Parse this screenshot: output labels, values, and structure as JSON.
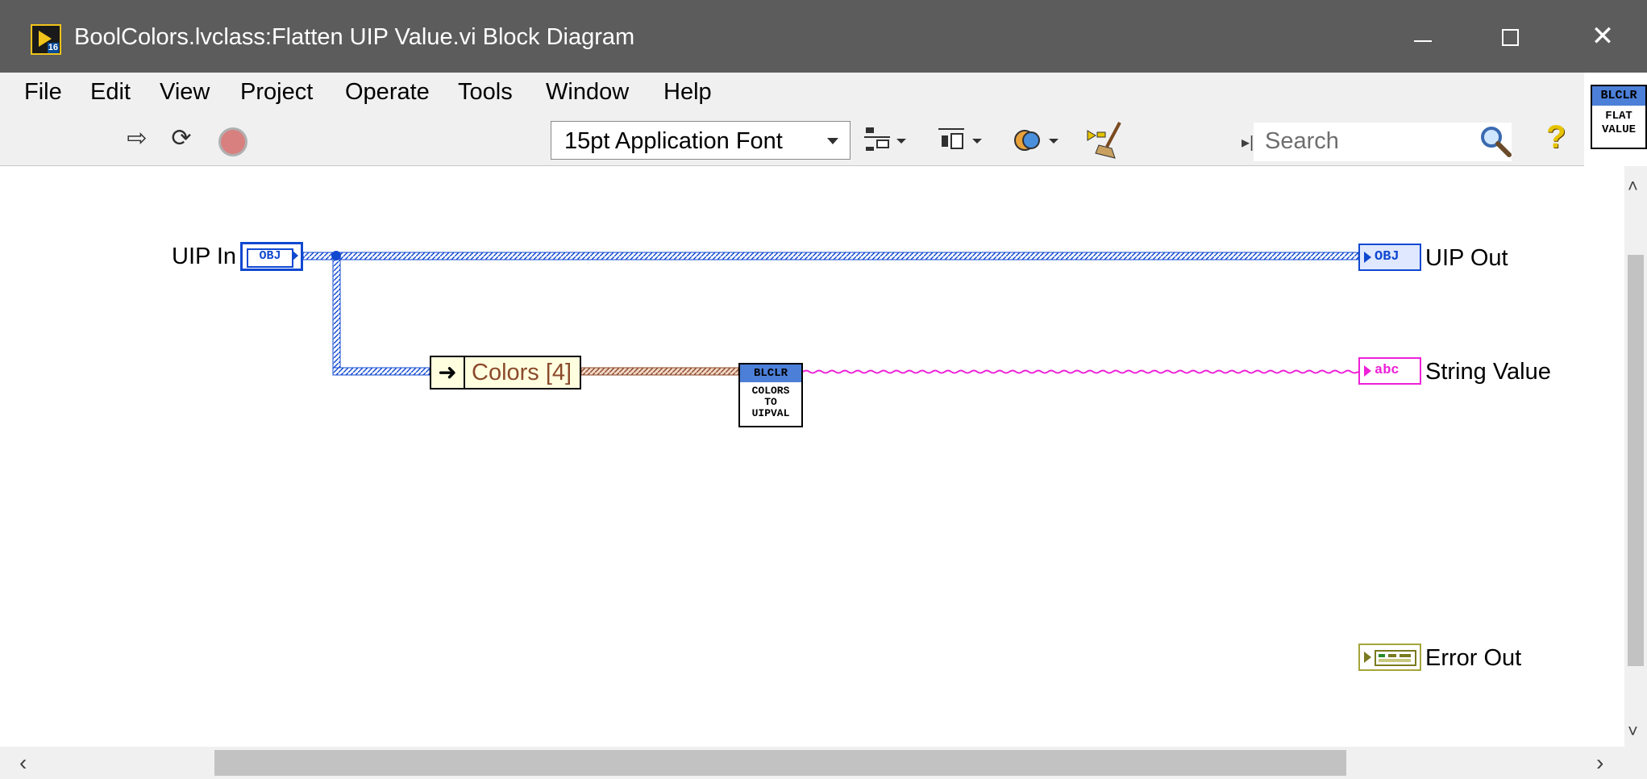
{
  "window": {
    "title": "BoolColors.lvclass:Flatten UIP Value.vi Block Diagram",
    "icon_number": "16",
    "controls": [
      "minimize",
      "maximize",
      "close"
    ]
  },
  "menu": {
    "items": [
      "File",
      "Edit",
      "View",
      "Project",
      "Operate",
      "Tools",
      "Window",
      "Help"
    ]
  },
  "toolbar": {
    "font_select_value": "15pt Application Font",
    "search_placeholder": "Search",
    "icons": [
      "run-arrow-icon",
      "run-continuously-icon",
      "abort-icon",
      "align-icon",
      "distribute-icon",
      "reorder-icon",
      "cleanup-icon",
      "search-icon",
      "help-icon"
    ]
  },
  "vi_icon": {
    "banner": "BLCLR",
    "line1": "FLAT",
    "line2": "VALUE"
  },
  "diagram": {
    "uip_in_label": "UIP In",
    "uip_in_terminal": "OBJ",
    "uip_out_label": "UIP Out",
    "uip_out_terminal": "OBJ",
    "string_value_label": "String Value",
    "string_value_terminal": "abc",
    "error_out_label": "Error Out",
    "error_out_terminal": "",
    "unbundle_label": "Colors [4]",
    "subvi": {
      "banner": "BLCLR",
      "line1": "COLORS",
      "line2": "TO",
      "line3": "UIPVAL"
    }
  },
  "colors": {
    "titlebar": "#5c5c5c",
    "class_wire": "#1048d0",
    "cluster_wire": "#8b4a2b",
    "string_wire": "#ee20d8",
    "error_wire": "#a5a53a"
  }
}
